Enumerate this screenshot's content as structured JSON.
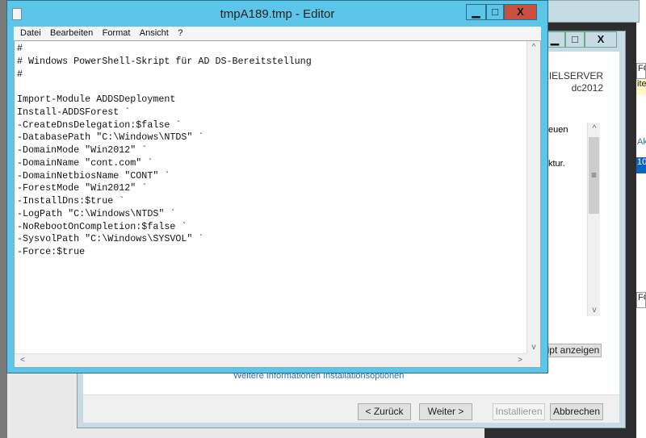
{
  "editor": {
    "title": "tmpA189.tmp - Editor",
    "menu": [
      "Datei",
      "Bearbeiten",
      "Format",
      "Ansicht",
      "?"
    ],
    "lines": [
      "#",
      "# Windows PowerShell-Skript für AD DS-Bereitstellung",
      "#",
      "",
      "Import-Module ADDSDeployment",
      "Install-ADDSForest `",
      "-CreateDnsDelegation:$false `",
      "-DatabasePath \"C:\\Windows\\NTDS\" `",
      "-DomainMode \"Win2012\" `",
      "-DomainName \"cont.com\" `",
      "-DomainNetbiosName \"CONT\" `",
      "-ForestMode \"Win2012\" `",
      "-InstallDns:$true `",
      "-LogPath \"C:\\Windows\\NTDS\" `",
      "-NoRebootOnCompletion:$false `",
      "-SysvolPath \"C:\\Windows\\SYSVOL\" `",
      "-Force:$true"
    ]
  },
  "wizard": {
    "target_label": "ZIELSERVER",
    "target_name": "dc2012",
    "partial_text_1": "euen",
    "partial_text_2": "ktur.",
    "script_button": "ript anzeigen",
    "more_info_link": "Weitere Informationen Installationsoptionen",
    "back": "< Zurück",
    "next": "Weiter >",
    "install": "Installieren",
    "cancel": "Abbrechen"
  },
  "server_manager": {
    "fg1": "FG",
    "item1": "ite",
    "link": "Ak",
    "selected": "10",
    "fg2": "FG"
  },
  "controls": {
    "minimize": "▁",
    "maximize": "□",
    "close": "X"
  }
}
